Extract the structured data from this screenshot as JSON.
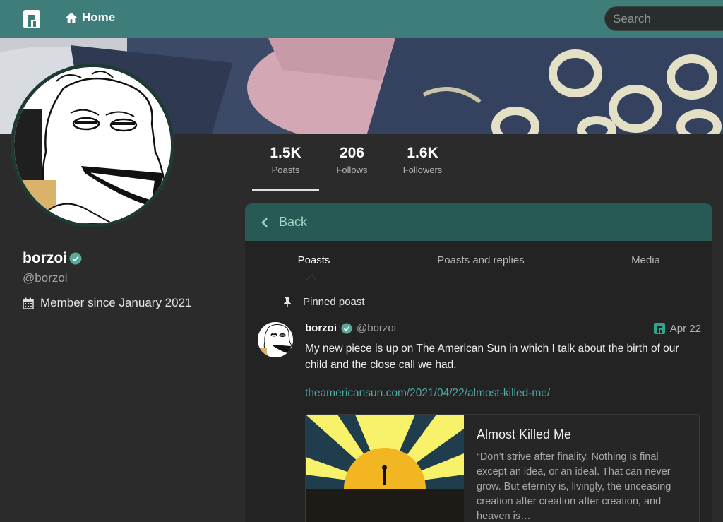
{
  "topbar": {
    "home_label": "Home",
    "search_placeholder": "Search"
  },
  "profile": {
    "name": "borzoi",
    "handle": "@borzoi",
    "member_since": "Member since January 2021",
    "stats": [
      {
        "value": "1.5K",
        "label": "Poasts"
      },
      {
        "value": "206",
        "label": "Follows"
      },
      {
        "value": "1.6K",
        "label": "Followers"
      }
    ]
  },
  "main": {
    "back_label": "Back",
    "tabs": [
      {
        "label": "Poasts"
      },
      {
        "label": "Poasts and replies"
      },
      {
        "label": "Media"
      }
    ],
    "pinned_label": "Pinned poast",
    "post": {
      "name": "borzoi",
      "handle": "@borzoi",
      "date": "Apr 22",
      "text": "My new piece is up on The American Sun in which I talk about the birth of our child and the close call we had.",
      "link": "theamericansun.com/2021/04/22/almost-killed-me/",
      "card": {
        "title": "Almost Killed Me",
        "description": "“Don’t strive after finality. Nothing is final except an idea, or an ideal. That can never grow. But eternity is, livingly, the unceasing creation after creation after creation, and heaven is…"
      }
    }
  },
  "colors": {
    "accent": "#3e7d7a",
    "back_bar": "#285a55",
    "link": "#4eaaa0",
    "verified": "#5aa89a"
  }
}
